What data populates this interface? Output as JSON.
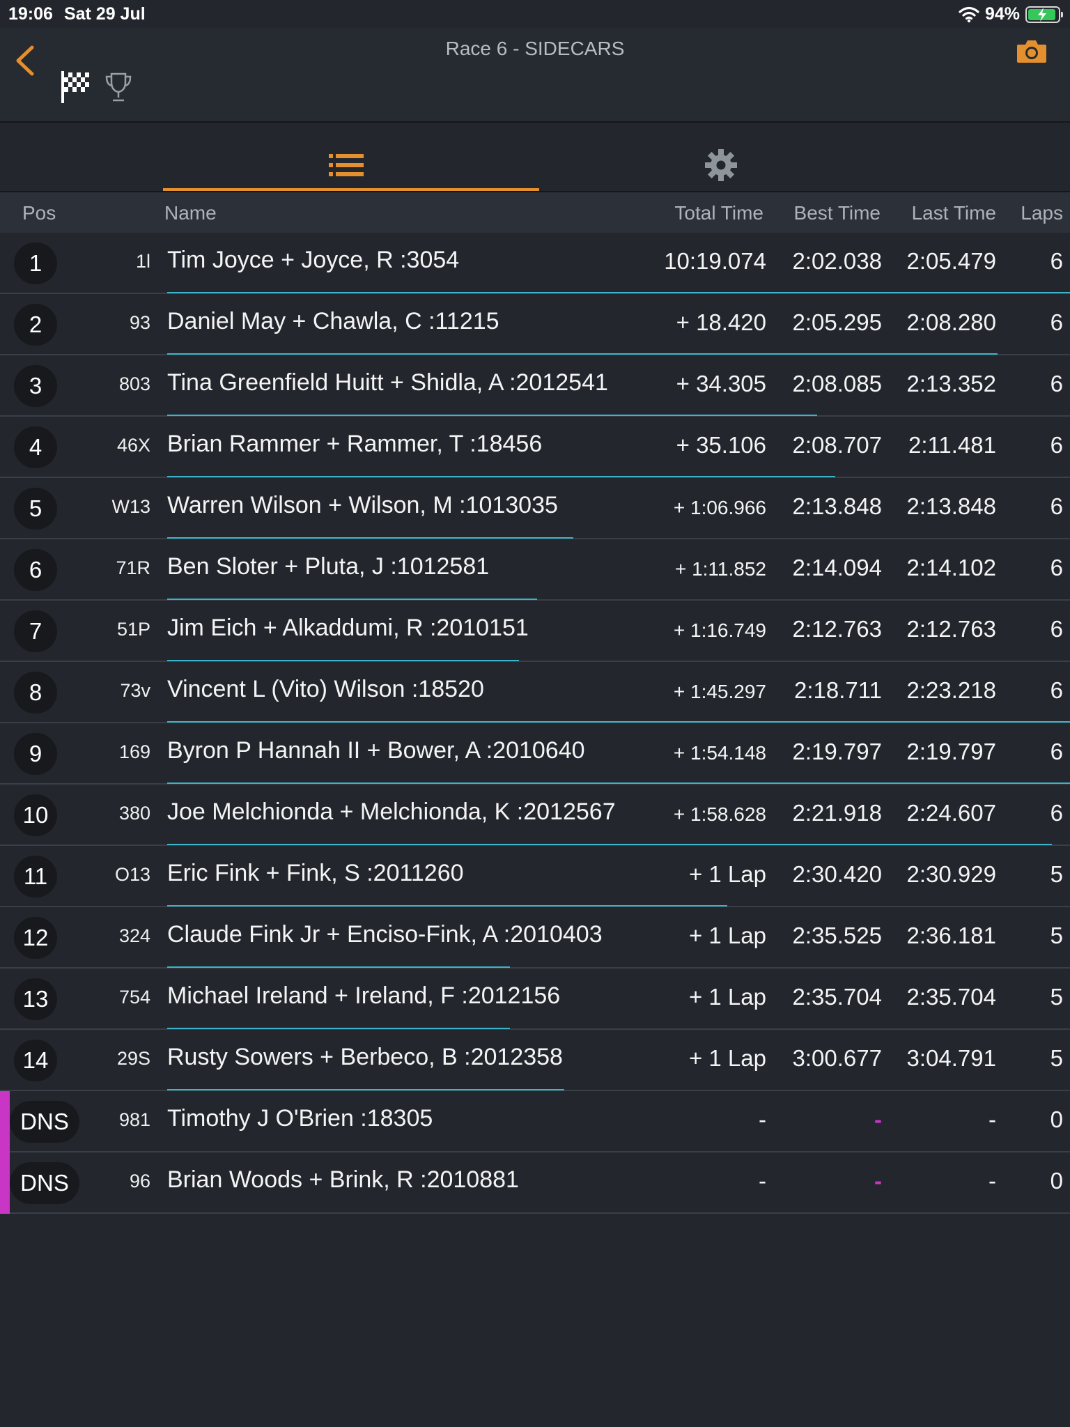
{
  "status": {
    "time": "19:06",
    "date": "Sat 29 Jul",
    "battery": "94%",
    "battery_level": 0.94
  },
  "nav": {
    "title": "Race 6 - SIDECARS",
    "back_icon": "chevron-left-icon",
    "camera_icon": "camera-icon",
    "flag_icon": "checkered-flag-icon",
    "trophy_icon": "trophy-icon"
  },
  "tabs": [
    {
      "icon": "list-icon",
      "active": true
    },
    {
      "icon": "gear-icon",
      "active": false
    }
  ],
  "columns": {
    "pos": "Pos",
    "name": "Name",
    "total": "Total Time",
    "best": "Best Time",
    "last": "Last Time",
    "laps": "Laps"
  },
  "accent_color": "#e5902f",
  "rows": [
    {
      "pos": "1",
      "num": "1l",
      "name": "Tim Joyce + Joyce, R :3054",
      "total": "10:19.074",
      "best": "2:02.038",
      "last": "2:05.479",
      "laps": "6",
      "progress": 1.0
    },
    {
      "pos": "2",
      "num": "93",
      "name": "Daniel May + Chawla, C :11215",
      "total": "+ 18.420",
      "best": "2:05.295",
      "last": "2:08.280",
      "laps": "6",
      "progress": 0.92
    },
    {
      "pos": "3",
      "num": "803",
      "name": "Tina Greenfield Huitt + Shidla, A :2012541",
      "total": "+ 34.305",
      "best": "2:08.085",
      "last": "2:13.352",
      "laps": "6",
      "progress": 0.72
    },
    {
      "pos": "4",
      "num": "46X",
      "name": "Brian Rammer + Rammer, T :18456",
      "total": "+ 35.106",
      "best": "2:08.707",
      "last": "2:11.481",
      "laps": "6",
      "progress": 0.74
    },
    {
      "pos": "5",
      "num": "W13",
      "name": "Warren Wilson + Wilson, M :1013035",
      "total": "+ 1:06.966",
      "best": "2:13.848",
      "last": "2:13.848",
      "laps": "6",
      "progress": 0.45
    },
    {
      "pos": "6",
      "num": "71R",
      "name": "Ben Sloter + Pluta, J :1012581",
      "total": "+ 1:11.852",
      "best": "2:14.094",
      "last": "2:14.102",
      "laps": "6",
      "progress": 0.41
    },
    {
      "pos": "7",
      "num": "51P",
      "name": "Jim Eich + Alkaddumi, R :2010151",
      "total": "+ 1:16.749",
      "best": "2:12.763",
      "last": "2:12.763",
      "laps": "6",
      "progress": 0.39
    },
    {
      "pos": "8",
      "num": "73v",
      "name": "Vincent L (Vito) Wilson :18520",
      "total": "+ 1:45.297",
      "best": "2:18.711",
      "last": "2:23.218",
      "laps": "6",
      "progress": 1.0
    },
    {
      "pos": "9",
      "num": "169",
      "name": "Byron P Hannah II + Bower, A :2010640",
      "total": "+ 1:54.148",
      "best": "2:19.797",
      "last": "2:19.797",
      "laps": "6",
      "progress": 1.0
    },
    {
      "pos": "10",
      "num": "380",
      "name": "Joe Melchionda + Melchionda, K :2012567",
      "total": "+ 1:58.628",
      "best": "2:21.918",
      "last": "2:24.607",
      "laps": "6",
      "progress": 0.98
    },
    {
      "pos": "11",
      "num": "O13",
      "name": "Eric Fink + Fink, S :2011260",
      "total": "+ 1 Lap",
      "best": "2:30.420",
      "last": "2:30.929",
      "laps": "5",
      "progress": 0.62
    },
    {
      "pos": "12",
      "num": "324",
      "name": "Claude Fink Jr + Enciso-Fink, A :2010403",
      "total": "+ 1 Lap",
      "best": "2:35.525",
      "last": "2:36.181",
      "laps": "5",
      "progress": 0.38
    },
    {
      "pos": "13",
      "num": "754",
      "name": "Michael Ireland + Ireland, F :2012156",
      "total": "+ 1 Lap",
      "best": "2:35.704",
      "last": "2:35.704",
      "laps": "5",
      "progress": 0.38
    },
    {
      "pos": "14",
      "num": "29S",
      "name": "Rusty Sowers + Berbeco, B :2012358",
      "total": "+ 1 Lap",
      "best": "3:00.677",
      "last": "3:04.791",
      "laps": "5",
      "progress": 0.44
    },
    {
      "pos": "DNS",
      "num": "981",
      "name": "Timothy J O'Brien :18305",
      "total": "-",
      "best": "-",
      "last": "-",
      "laps": "0",
      "progress": 0,
      "dns": true
    },
    {
      "pos": "DNS",
      "num": "96",
      "name": "Brian Woods + Brink, R :2010881",
      "total": "-",
      "best": "-",
      "last": "-",
      "laps": "0",
      "progress": 0,
      "dns": true
    }
  ]
}
